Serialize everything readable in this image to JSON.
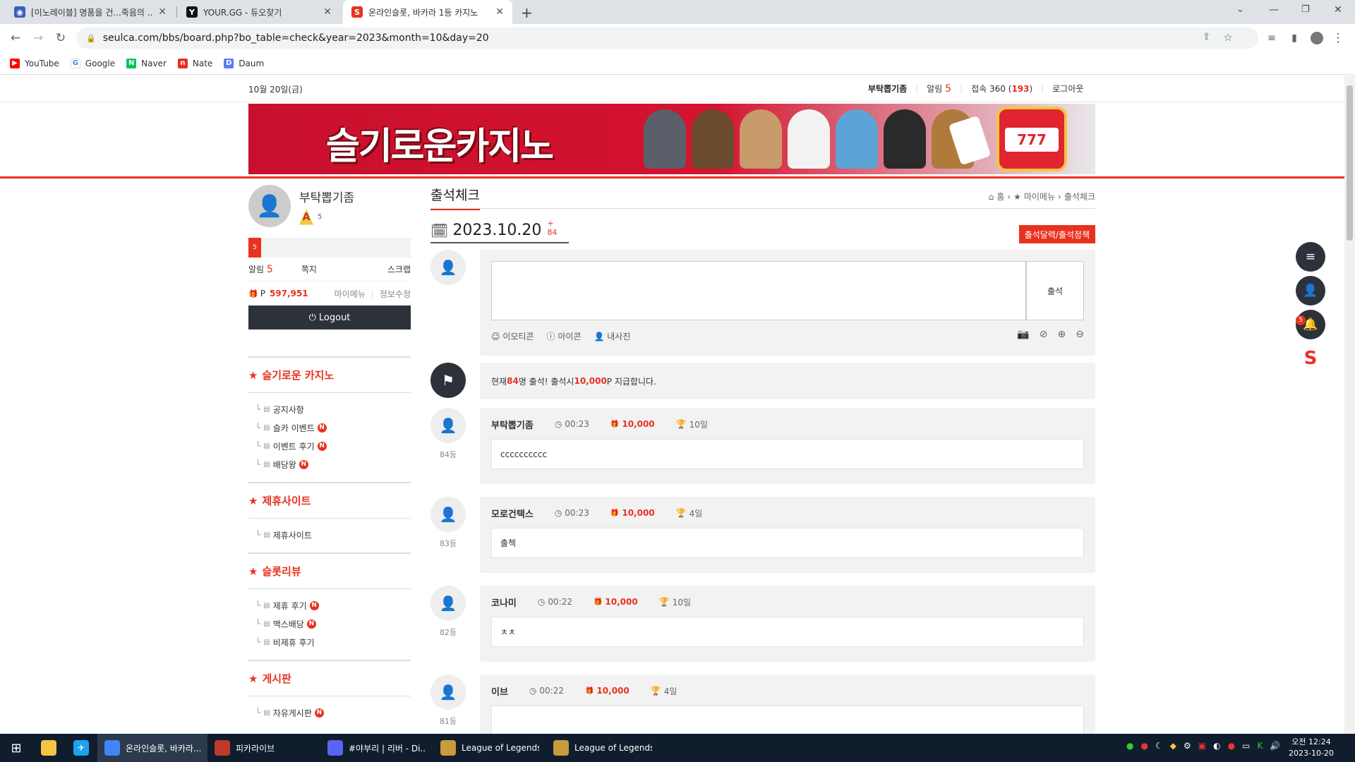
{
  "browser": {
    "tabs": [
      {
        "title": "[이노레이블] 명품을 건...죽음의 ..."
      },
      {
        "title": "YOUR.GG - 듀오찾기"
      },
      {
        "title": "온라인슬롯, 바카라 1등 카지노"
      }
    ],
    "url": "seulca.com/bbs/board.php?bo_table=check&year=2023&month=10&day=20",
    "bookmarks": [
      "YouTube",
      "Google",
      "Naver",
      "Nate",
      "Daum"
    ]
  },
  "topbar": {
    "date": "10월 20일(금)",
    "username": "부탁뽑기좀",
    "alarm_label": "알림",
    "alarm_count": "5",
    "visit_label": "접속 360 (",
    "visit_highlight": "193",
    "visit_close": ")",
    "logout": "로그아웃"
  },
  "banner": {
    "title": "슬기로운카지노"
  },
  "profile": {
    "name": "부탁뽑기좀",
    "level": "5",
    "progress_label": "5",
    "alarm_label": "알림",
    "alarm_count": "5",
    "memo": "쪽지",
    "scrap": "스크랩",
    "point_prefix": "P",
    "points": "597,951",
    "mymenu": "마이메뉴",
    "edit": "정보수정",
    "logout_btn": "Logout"
  },
  "menu": [
    {
      "title": "슬기로운 카지노",
      "items": [
        {
          "label": "공지사항",
          "new": false
        },
        {
          "label": "슬카 이벤트",
          "new": true
        },
        {
          "label": "이벤트 후기",
          "new": true
        },
        {
          "label": "배당왕",
          "new": true
        }
      ]
    },
    {
      "title": "제휴사이트",
      "items": [
        {
          "label": "제휴사이트",
          "new": false
        }
      ]
    },
    {
      "title": "슬롯리뷰",
      "items": [
        {
          "label": "제휴 후기",
          "new": true
        },
        {
          "label": "맥스배당",
          "new": true
        },
        {
          "label": "비제휴 후기",
          "new": false
        }
      ]
    },
    {
      "title": "게시판",
      "items": [
        {
          "label": "자유게시판",
          "new": true
        }
      ]
    }
  ],
  "main": {
    "page_title": "출석체크",
    "breadcrumb": [
      "홈",
      "마이메뉴",
      "출석체크"
    ],
    "date": "2023.10.20",
    "date_count": "+ 84",
    "policy_btn": "출석달력/출석정책",
    "submit_btn": "출석",
    "tools": [
      "이모티콘",
      "아이콘",
      "내사진"
    ],
    "notice_prefix": "현재 ",
    "notice_count": "84",
    "notice_mid": "명 출석! 출석시 ",
    "notice_points": "10,000",
    "notice_suffix": "P 지급합니다.",
    "posts": [
      {
        "name": "부탁뽑기좀",
        "time": "00:23",
        "points": "10,000",
        "days": "10일",
        "rank": "84등",
        "body": "cccccccccc"
      },
      {
        "name": "모로건택스",
        "time": "00:23",
        "points": "10,000",
        "days": "4일",
        "rank": "83등",
        "body": "출첵"
      },
      {
        "name": "코나미",
        "time": "00:22",
        "points": "10,000",
        "days": "10일",
        "rank": "82등",
        "body": "ㅊㅊ"
      },
      {
        "name": "이브",
        "time": "00:22",
        "points": "10,000",
        "days": "4일",
        "rank": "81등",
        "body": ""
      }
    ]
  },
  "floating": {
    "alarm_badge": "5"
  },
  "taskbar": {
    "items": [
      "온라인슬롯, 바카라...",
      "피카라이브",
      "#야부리 | 리버 - Di...",
      "League of Legends",
      "League of Legends..."
    ],
    "time": "오전 12:24",
    "date": "2023-10-20"
  }
}
